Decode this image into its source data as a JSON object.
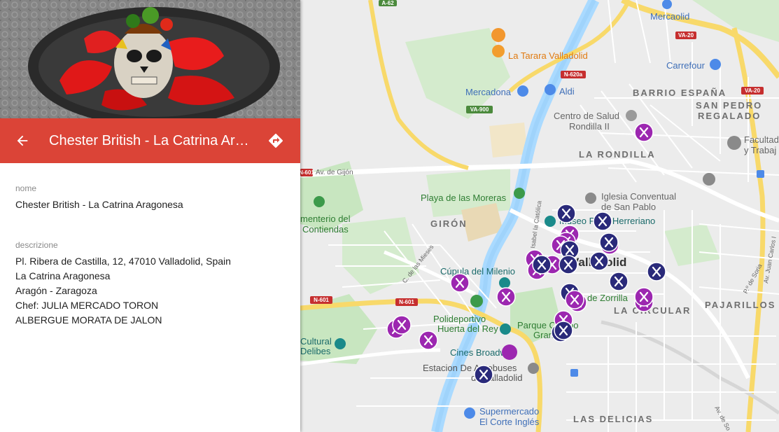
{
  "place": {
    "title": "Chester British - La Catrina Aragonesa",
    "nome_label": "nome",
    "nome_value": "Chester British - La Catrina Aragonesa",
    "descrizione_label": "descrizione",
    "description_lines": [
      "Pl. Ribera de Castilla, 12, 47010 Valladolid, Spain",
      "La Catrina Aragonesa",
      "Aragón - Zaragoza",
      "Chef: JULIA MERCADO TORON",
      "ALBERGUE MORATA DE JALON"
    ]
  },
  "colors": {
    "header_red": "#db4437",
    "marker_purple": "#9c27b0",
    "marker_navy": "#2a2a7a",
    "water": "#aadaff",
    "park": "#c8e6c0",
    "road_yellow": "#f8d96a"
  },
  "icons": {
    "back": "arrow-back-icon",
    "directions": "directions-icon",
    "marker": "restaurant-marker-icon"
  },
  "map": {
    "areas": [
      "BARRIO ESPAÑA",
      "SAN PEDRO",
      "REGALADO",
      "LA RONDILLA",
      "GIRÓN",
      "LA CIRCULAR",
      "PAJARILLOS",
      "LAS DELICIAS"
    ],
    "pois": {
      "mercaolid": "Mercaolid",
      "tarara": "La Tarara Valladolid",
      "mercadona": "Mercadona",
      "aldi": "Aldi",
      "centro_salud_1": "Centro de Salud",
      "centro_salud_2": "Rondilla II",
      "carrefour": "Carrefour",
      "facultad_1": "Facultad",
      "facultad_2": "y Trabaj",
      "playa": "Playa de las Moreras",
      "iglesia_1": "Iglesia Conventual",
      "iglesia_2": "de San Pablo",
      "museo": "Museo Patio Herreriano",
      "cementerio_1": "menterio del",
      "cementerio_2": "Contiendas",
      "cupula": "Cúpula del Milenio",
      "valladolid": "Valladolid",
      "zorrilla": "de Zorrilla",
      "polideportivo_1": "Polideportivo",
      "polideportivo_2": "Huerta del Rey",
      "parque_1": "Parque Campo",
      "parque_2": "Grande",
      "cultural_1": "Cultural",
      "cultural_2": "Delibes",
      "cines": "Cines Broadway",
      "estacion_1": "Estacion De Autobuses",
      "estacion_2": "de Valladolid",
      "supermercado_1": "Supermercado",
      "supermercado_2": "El Corte Inglés"
    },
    "streets": {
      "gijon": "Av. de Gijón",
      "mieses": "C. de las Mieses",
      "catolica": "Isabel la Católica",
      "juan_carlos": "Av. Juan Carlos I",
      "soria": "P.º de Soria",
      "av_so": "Av. de So"
    },
    "roads": [
      "A-62",
      "VA-20",
      "N-620a",
      "VA-900",
      "N-601",
      "N-601",
      "N-601",
      "VA-20"
    ]
  }
}
